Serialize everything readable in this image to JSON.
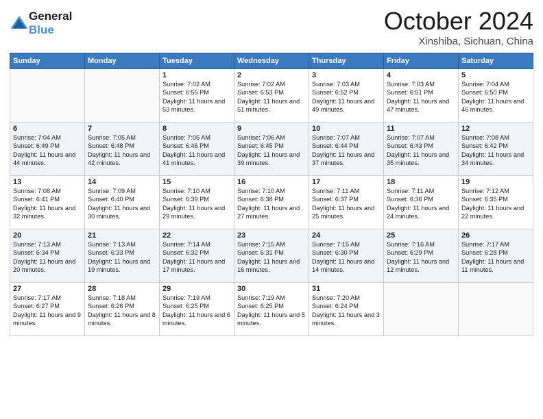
{
  "logo": {
    "line1": "General",
    "line2": "Blue"
  },
  "title": "October 2024",
  "location": "Xinshiba, Sichuan, China",
  "headers": [
    "Sunday",
    "Monday",
    "Tuesday",
    "Wednesday",
    "Thursday",
    "Friday",
    "Saturday"
  ],
  "weeks": [
    [
      {
        "day": "",
        "content": ""
      },
      {
        "day": "",
        "content": ""
      },
      {
        "day": "1",
        "content": "Sunrise: 7:02 AM\nSunset: 6:55 PM\nDaylight: 11 hours and 53 minutes."
      },
      {
        "day": "2",
        "content": "Sunrise: 7:02 AM\nSunset: 6:53 PM\nDaylight: 11 hours and 51 minutes."
      },
      {
        "day": "3",
        "content": "Sunrise: 7:03 AM\nSunset: 6:52 PM\nDaylight: 11 hours and 49 minutes."
      },
      {
        "day": "4",
        "content": "Sunrise: 7:03 AM\nSunset: 6:51 PM\nDaylight: 11 hours and 47 minutes."
      },
      {
        "day": "5",
        "content": "Sunrise: 7:04 AM\nSunset: 6:50 PM\nDaylight: 11 hours and 46 minutes."
      }
    ],
    [
      {
        "day": "6",
        "content": "Sunrise: 7:04 AM\nSunset: 6:49 PM\nDaylight: 11 hours and 44 minutes."
      },
      {
        "day": "7",
        "content": "Sunrise: 7:05 AM\nSunset: 6:48 PM\nDaylight: 11 hours and 42 minutes."
      },
      {
        "day": "8",
        "content": "Sunrise: 7:05 AM\nSunset: 6:46 PM\nDaylight: 11 hours and 41 minutes."
      },
      {
        "day": "9",
        "content": "Sunrise: 7:06 AM\nSunset: 6:45 PM\nDaylight: 11 hours and 39 minutes."
      },
      {
        "day": "10",
        "content": "Sunrise: 7:07 AM\nSunset: 6:44 PM\nDaylight: 11 hours and 37 minutes."
      },
      {
        "day": "11",
        "content": "Sunrise: 7:07 AM\nSunset: 6:43 PM\nDaylight: 11 hours and 35 minutes."
      },
      {
        "day": "12",
        "content": "Sunrise: 7:08 AM\nSunset: 6:42 PM\nDaylight: 11 hours and 34 minutes."
      }
    ],
    [
      {
        "day": "13",
        "content": "Sunrise: 7:08 AM\nSunset: 6:41 PM\nDaylight: 11 hours and 32 minutes."
      },
      {
        "day": "14",
        "content": "Sunrise: 7:09 AM\nSunset: 6:40 PM\nDaylight: 11 hours and 30 minutes."
      },
      {
        "day": "15",
        "content": "Sunrise: 7:10 AM\nSunset: 6:39 PM\nDaylight: 11 hours and 29 minutes."
      },
      {
        "day": "16",
        "content": "Sunrise: 7:10 AM\nSunset: 6:38 PM\nDaylight: 11 hours and 27 minutes."
      },
      {
        "day": "17",
        "content": "Sunrise: 7:11 AM\nSunset: 6:37 PM\nDaylight: 11 hours and 25 minutes."
      },
      {
        "day": "18",
        "content": "Sunrise: 7:11 AM\nSunset: 6:36 PM\nDaylight: 11 hours and 24 minutes."
      },
      {
        "day": "19",
        "content": "Sunrise: 7:12 AM\nSunset: 6:35 PM\nDaylight: 11 hours and 22 minutes."
      }
    ],
    [
      {
        "day": "20",
        "content": "Sunrise: 7:13 AM\nSunset: 6:34 PM\nDaylight: 11 hours and 20 minutes."
      },
      {
        "day": "21",
        "content": "Sunrise: 7:13 AM\nSunset: 6:33 PM\nDaylight: 11 hours and 19 minutes."
      },
      {
        "day": "22",
        "content": "Sunrise: 7:14 AM\nSunset: 6:32 PM\nDaylight: 11 hours and 17 minutes."
      },
      {
        "day": "23",
        "content": "Sunrise: 7:15 AM\nSunset: 6:31 PM\nDaylight: 11 hours and 16 minutes."
      },
      {
        "day": "24",
        "content": "Sunrise: 7:15 AM\nSunset: 6:30 PM\nDaylight: 11 hours and 14 minutes."
      },
      {
        "day": "25",
        "content": "Sunrise: 7:16 AM\nSunset: 6:29 PM\nDaylight: 11 hours and 12 minutes."
      },
      {
        "day": "26",
        "content": "Sunrise: 7:17 AM\nSunset: 6:28 PM\nDaylight: 11 hours and 11 minutes."
      }
    ],
    [
      {
        "day": "27",
        "content": "Sunrise: 7:17 AM\nSunset: 6:27 PM\nDaylight: 11 hours and 9 minutes."
      },
      {
        "day": "28",
        "content": "Sunrise: 7:18 AM\nSunset: 6:26 PM\nDaylight: 11 hours and 8 minutes."
      },
      {
        "day": "29",
        "content": "Sunrise: 7:19 AM\nSunset: 6:25 PM\nDaylight: 11 hours and 6 minutes."
      },
      {
        "day": "30",
        "content": "Sunrise: 7:19 AM\nSunset: 6:25 PM\nDaylight: 11 hours and 5 minutes."
      },
      {
        "day": "31",
        "content": "Sunrise: 7:20 AM\nSunset: 6:24 PM\nDaylight: 11 hours and 3 minutes."
      },
      {
        "day": "",
        "content": ""
      },
      {
        "day": "",
        "content": ""
      }
    ]
  ]
}
